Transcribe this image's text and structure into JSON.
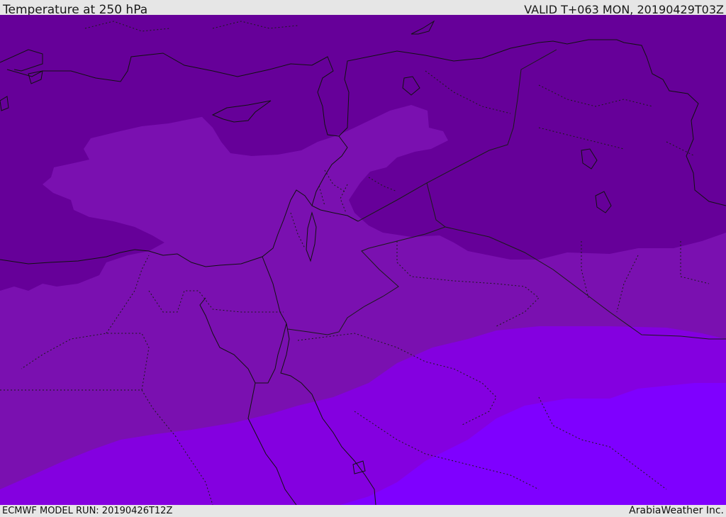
{
  "header": {
    "title": "Temperature at 250 hPa",
    "valid": "VALID T+063 MON, 20190429T03Z"
  },
  "footer": {
    "model_run": "ECMWF MODEL RUN: 20190426T12Z",
    "credit": "ArabiaWeather Inc."
  },
  "colors": {
    "band_coldest": "#660099",
    "band_cold": "#7a10b0",
    "band_mid": "#8400e0",
    "band_warm": "#7f00ff",
    "coastline": "#111111",
    "borders": "#1a1a1a",
    "background": "#e6e6e6"
  }
}
